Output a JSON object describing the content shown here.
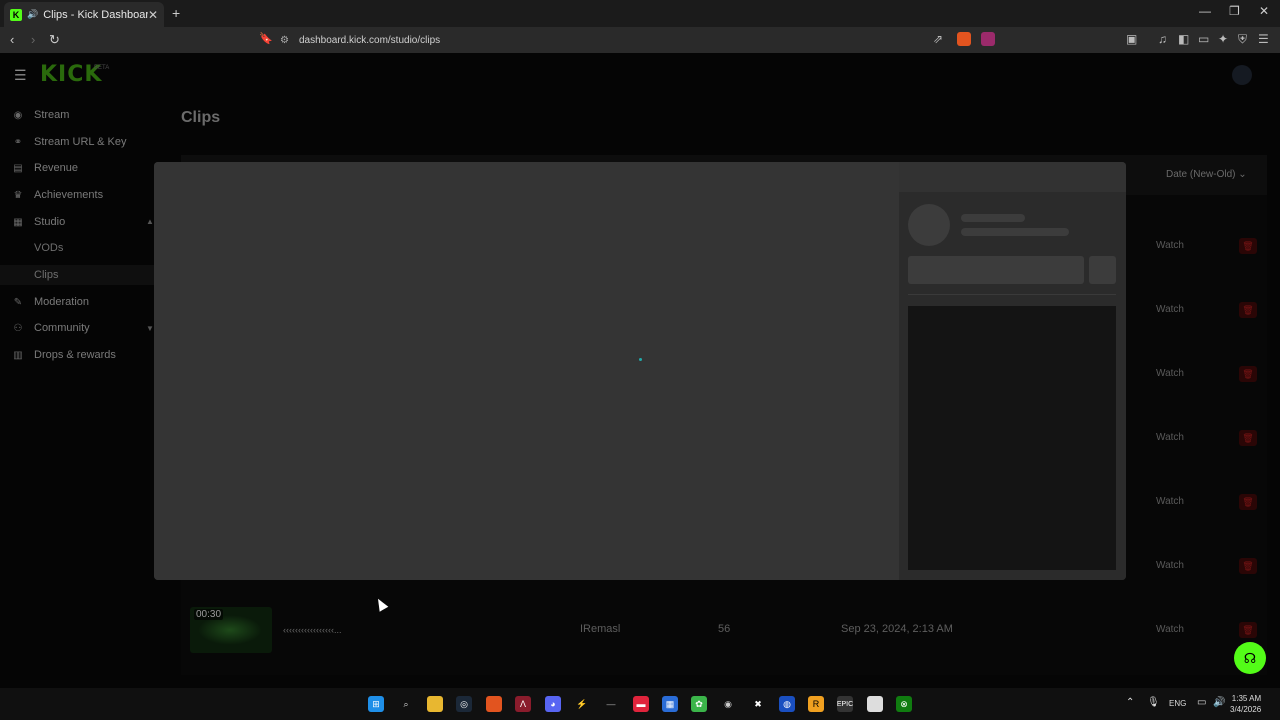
{
  "browser": {
    "tab_title": "Clips - Kick Dashboard",
    "tab_favicon": "K",
    "tab_close": "✕",
    "new_tab": "+",
    "url": "dashboard.kick.com/studio/clips",
    "window": {
      "minimize": "—",
      "maximize": "❐",
      "close": "✕"
    }
  },
  "header": {
    "logo": "KICK",
    "logo_badge": "BETA"
  },
  "sidebar": {
    "items": [
      {
        "label": "Stream",
        "icon": "broadcast-icon",
        "glyph": "((·))"
      },
      {
        "label": "Stream URL & Key",
        "icon": "link-icon",
        "glyph": "⛓"
      },
      {
        "label": "Revenue",
        "icon": "revenue-icon",
        "glyph": "▤"
      },
      {
        "label": "Achievements",
        "icon": "trophy-icon",
        "glyph": "🏆"
      },
      {
        "label": "Studio",
        "icon": "studio-icon",
        "glyph": "▦"
      },
      {
        "label": "Moderation",
        "icon": "wrench-icon",
        "glyph": "🔧"
      },
      {
        "label": "Community",
        "icon": "community-icon",
        "glyph": "⚇"
      },
      {
        "label": "Drops & rewards",
        "icon": "gift-icon",
        "glyph": "🎁"
      }
    ],
    "studio_sub": [
      {
        "label": "VODs"
      },
      {
        "label": "Clips"
      }
    ]
  },
  "main": {
    "title": "Clips",
    "sort_label": "Date (New-Old)",
    "row_action": "Watch",
    "last_row": {
      "duration": "00:30",
      "title": "‹‹‹‹‹‹‹‹‹‹‹‹‹‹‹‹‹...",
      "category": "IRemasl",
      "views": "56",
      "date": "Sep 23, 2024, 2:13 AM",
      "action": "Watch"
    }
  },
  "taskbar": {
    "time": "1:35 AM",
    "date": "3/4/2026",
    "lang": "ENG"
  },
  "colors": {
    "accent": "#53fc18",
    "delete": "#7a1515"
  }
}
